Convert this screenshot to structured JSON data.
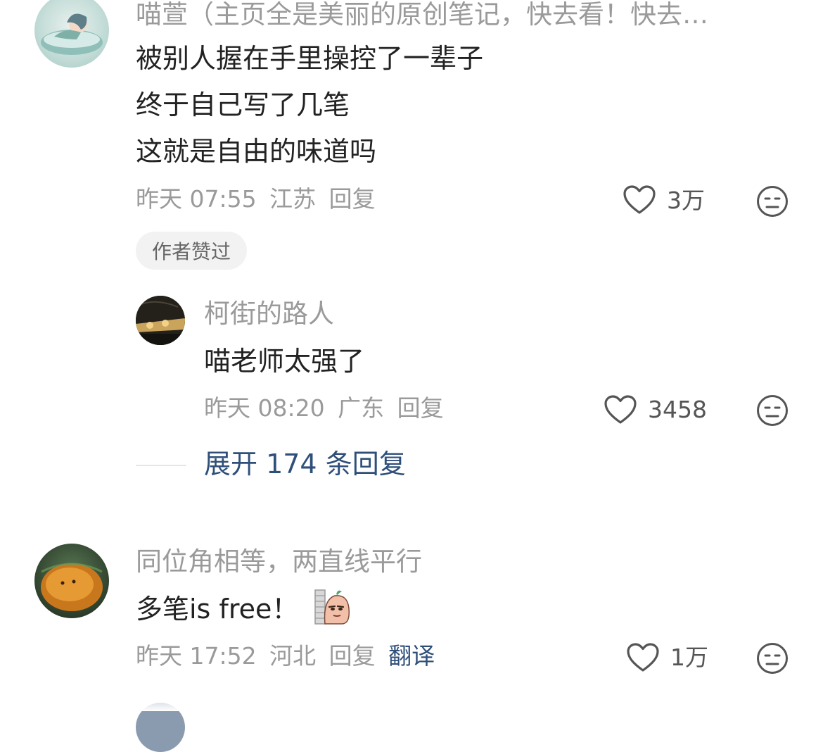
{
  "comments": [
    {
      "username": "喵萱（主页全是美丽的原创笔记，快去看！快去…",
      "lines": [
        "被别人握在手里操控了一辈子",
        "终于自己写了几笔",
        "这就是自由的味道吗"
      ],
      "time": "昨天 07:55",
      "location": "江苏",
      "reply_label": "回复",
      "likes": "3万",
      "badge": "作者赞过"
    },
    {
      "username": "柯街的路人",
      "lines": [
        "喵老师太强了"
      ],
      "time": "昨天 08:20",
      "location": "广东",
      "reply_label": "回复",
      "likes": "3458"
    },
    {
      "username": "同位角相等，两直线平行",
      "lines": [
        "多笔is free！"
      ],
      "time": "昨天 17:52",
      "location": "河北",
      "reply_label": "回复",
      "translate_label": "翻译",
      "likes": "1万"
    }
  ],
  "expand_replies": "展开 174 条回复",
  "icons": {
    "like": "heart-outline-icon",
    "dislike": "meh-face-icon",
    "sticker": "peeking-potato-sticker"
  },
  "colors": {
    "username": "#9a9a9a",
    "link": "#2f4f7a",
    "icon": "#555555"
  }
}
